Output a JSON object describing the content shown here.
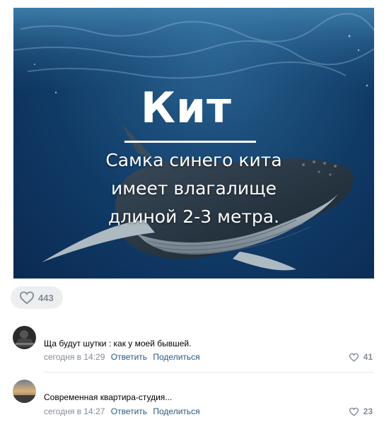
{
  "post": {
    "image": {
      "title": "Кит",
      "caption_lines": [
        "Самка синего кита",
        "имеет влагалище",
        "длиной 2-3 метра."
      ]
    },
    "likes": {
      "count": "443",
      "icon": "heart-outline-icon"
    }
  },
  "comments": [
    {
      "text": "Ща будут шутки : как у моей бывшей.",
      "time": "сегодня в 14:29",
      "reply_label": "Ответить",
      "share_label": "Поделиться",
      "likes": "41",
      "avatar": "dark-avatar"
    },
    {
      "text": "Современная квартира-студия...",
      "time": "сегодня в 14:27",
      "reply_label": "Ответить",
      "share_label": "Поделиться",
      "likes": "23",
      "avatar": "sunset-avatar"
    }
  ],
  "colors": {
    "link": "#2a5885",
    "muted": "#818c99",
    "pill_bg": "#edeef0",
    "divider": "#e7e8ec"
  }
}
